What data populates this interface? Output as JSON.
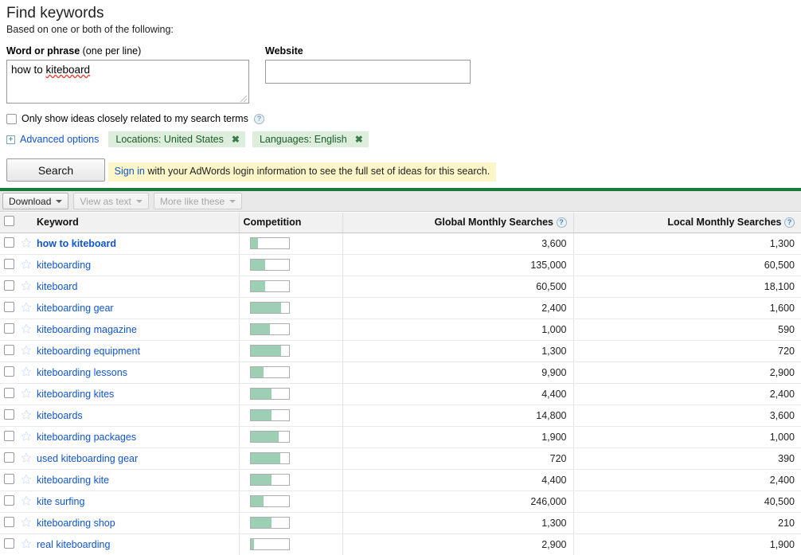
{
  "header": {
    "title": "Find keywords",
    "subtitle": "Based on one or both of the following:"
  },
  "form": {
    "keyword_label_bold": "Word or phrase",
    "keyword_label_sub": " (one per line)",
    "keyword_value": "how to kiteboard",
    "keyword_value_prefix": "how to ",
    "keyword_value_misspelled": "kiteboard",
    "website_label": "Website",
    "website_value": "",
    "website_placeholder": "",
    "only_closely_related_label": "Only show ideas closely related to my search terms",
    "help_icon": "question-mark-icon",
    "advanced_options_label": "Advanced options",
    "expand_icon": "plus-box-icon",
    "chips": [
      {
        "label": "Locations: United States",
        "remove": "✖"
      },
      {
        "label": "Languages: English",
        "remove": "✖"
      }
    ],
    "search_button": "Search"
  },
  "banner": {
    "link_text": "Sign in",
    "rest_text": " with your AdWords login information to see the full set of ideas for this search.",
    "background": "#fdf6c8"
  },
  "toolbar": {
    "download_label": "Download",
    "view_as_text_label": "View as text",
    "more_like_these_label": "More like these",
    "caret_icon": "chevron-down-icon"
  },
  "colors": {
    "green_bar": "#1a7a3c",
    "chip_bg": "#ddeedd",
    "chip_text": "#1d5b29",
    "competition_fill": "#9ccfb3",
    "link": "#1155cc"
  },
  "table": {
    "columns": {
      "keyword": "Keyword",
      "competition": "Competition",
      "global_monthly_searches": "Global Monthly Searches",
      "local_monthly_searches": "Local Monthly Searches"
    },
    "select_all_checkbox": "select-all",
    "rows": [
      {
        "keyword": "how to kiteboard",
        "bold": true,
        "competition": 20,
        "global": "3,600",
        "local": "1,300"
      },
      {
        "keyword": "kiteboarding",
        "bold": false,
        "competition": 38,
        "global": "135,000",
        "local": "60,500"
      },
      {
        "keyword": "kiteboard",
        "bold": false,
        "competition": 38,
        "global": "60,500",
        "local": "18,100"
      },
      {
        "keyword": "kiteboarding gear",
        "bold": false,
        "competition": 80,
        "global": "2,400",
        "local": "1,600"
      },
      {
        "keyword": "kiteboarding magazine",
        "bold": false,
        "competition": 52,
        "global": "1,000",
        "local": "590"
      },
      {
        "keyword": "kiteboarding equipment",
        "bold": false,
        "competition": 80,
        "global": "1,300",
        "local": "720"
      },
      {
        "keyword": "kiteboarding lessons",
        "bold": false,
        "competition": 34,
        "global": "9,900",
        "local": "2,900"
      },
      {
        "keyword": "kiteboarding kites",
        "bold": false,
        "competition": 56,
        "global": "4,400",
        "local": "2,400"
      },
      {
        "keyword": "kiteboards",
        "bold": false,
        "competition": 56,
        "global": "14,800",
        "local": "3,600"
      },
      {
        "keyword": "kiteboarding packages",
        "bold": false,
        "competition": 74,
        "global": "1,900",
        "local": "1,000"
      },
      {
        "keyword": "used kiteboarding gear",
        "bold": false,
        "competition": 78,
        "global": "720",
        "local": "390"
      },
      {
        "keyword": "kiteboarding kite",
        "bold": false,
        "competition": 56,
        "global": "4,400",
        "local": "2,400"
      },
      {
        "keyword": "kite surfing",
        "bold": false,
        "competition": 34,
        "global": "246,000",
        "local": "40,500"
      },
      {
        "keyword": "kiteboarding shop",
        "bold": false,
        "competition": 56,
        "global": "1,300",
        "local": "210"
      },
      {
        "keyword": "real kiteboarding",
        "bold": false,
        "competition": 10,
        "global": "2,900",
        "local": "1,900"
      }
    ]
  }
}
